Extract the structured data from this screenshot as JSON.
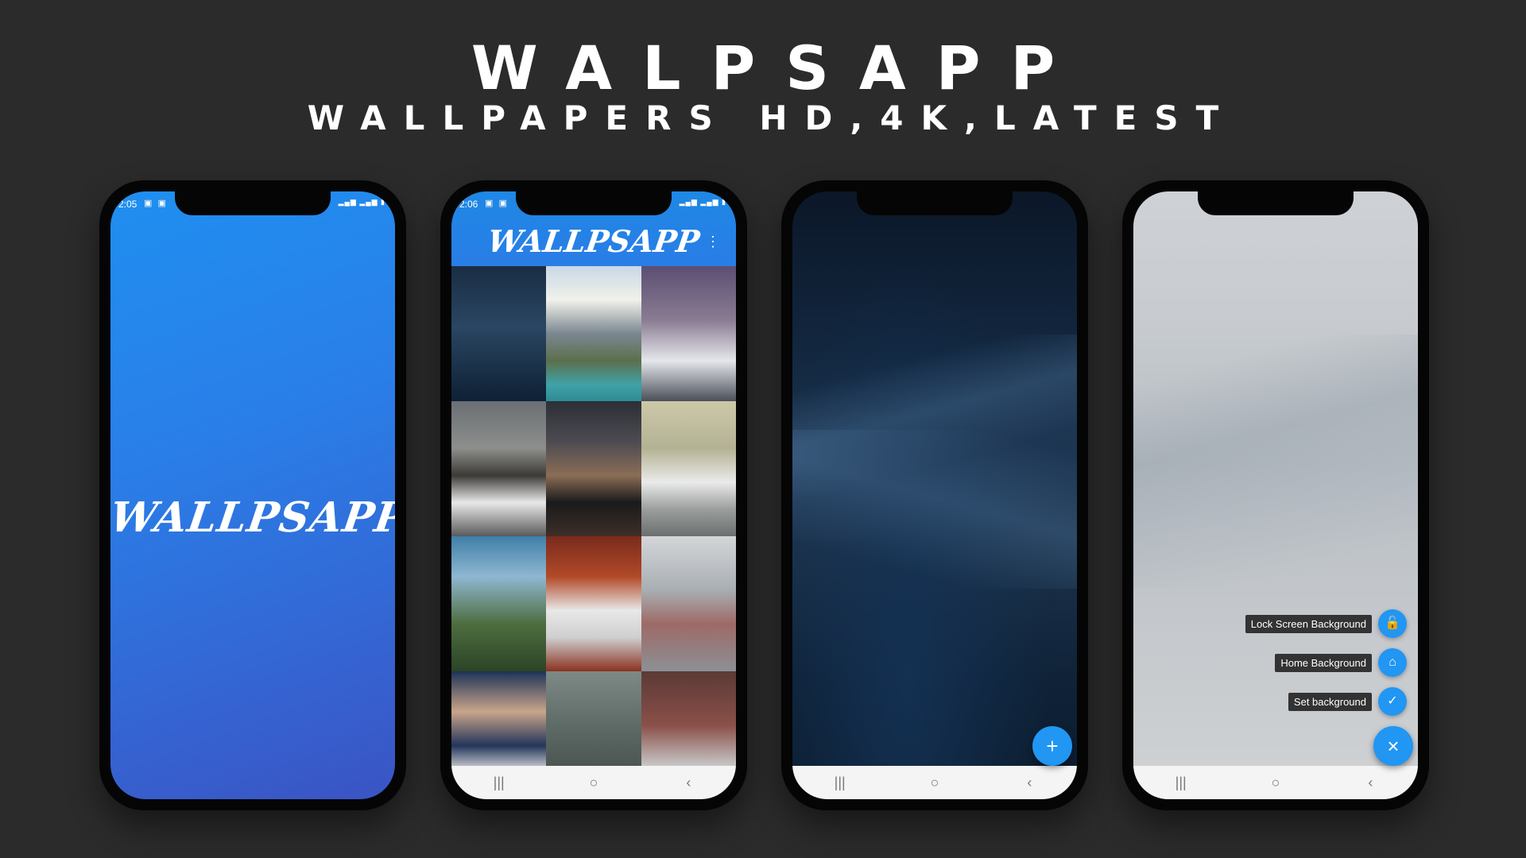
{
  "hero": {
    "title": "WALPSAPP",
    "subtitle": "WALLPAPERS HD,4K,LATEST"
  },
  "colors": {
    "background": "#2b2b2b",
    "accent": "#2196f3",
    "splash_gradient_start": "#1f8ff0",
    "splash_gradient_end": "#3b54c4"
  },
  "phone1": {
    "status_time": "2:05",
    "brand": "WALLPSAPP"
  },
  "phone2": {
    "status_time": "2:06",
    "brand": "WALLPSAPP",
    "menu_icon": "more-vert-icon"
  },
  "phone3": {
    "fab_label": "+"
  },
  "phone4": {
    "options": [
      {
        "label": "Lock Screen Background",
        "icon": "lock-icon",
        "glyph": "🔓"
      },
      {
        "label": "Home Background",
        "icon": "home-icon",
        "glyph": "⌂"
      },
      {
        "label": "Set background",
        "icon": "check-icon",
        "glyph": "✓"
      }
    ],
    "close_glyph": "×"
  },
  "navbar": {
    "recents": "|||",
    "home": "○",
    "back": "‹"
  }
}
